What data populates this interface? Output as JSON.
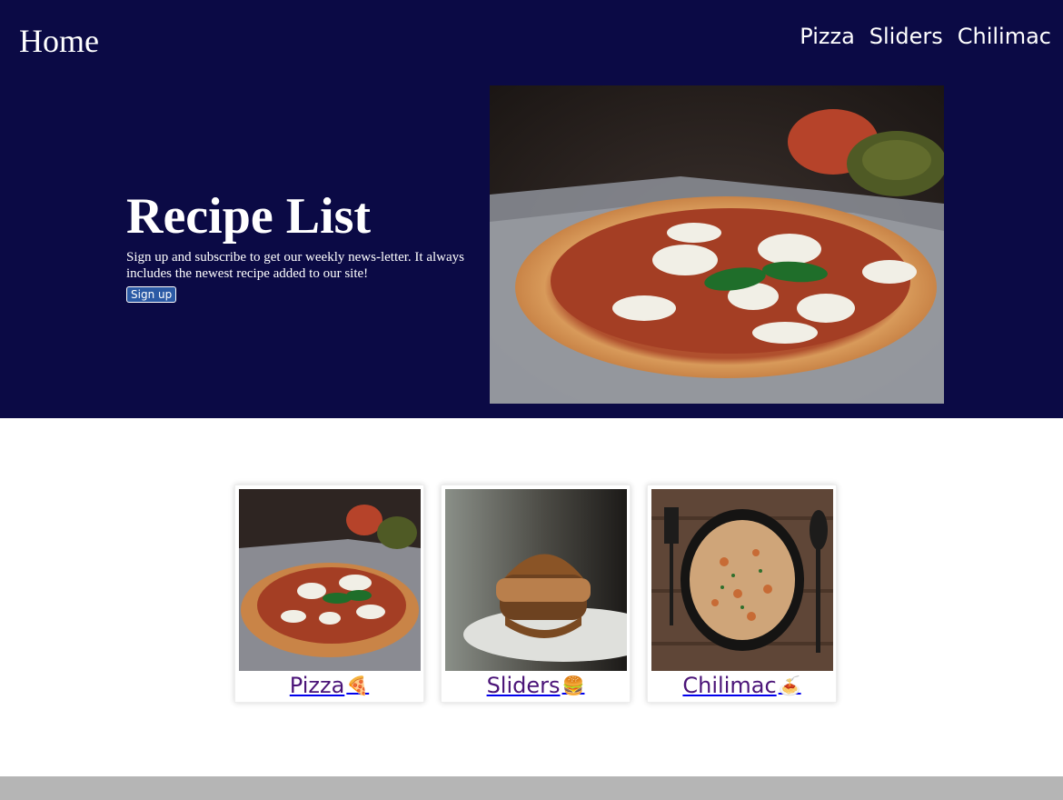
{
  "header": {
    "home_label": "Home",
    "nav": [
      {
        "label": "Pizza"
      },
      {
        "label": "Sliders"
      },
      {
        "label": "Chilimac"
      }
    ]
  },
  "hero": {
    "title": "Recipe List",
    "description": "Sign up and subscribe to get our weekly news-letter. It always includes the newest recipe added to our site!",
    "signup_label": "Sign up"
  },
  "cards": [
    {
      "label": "Pizza",
      "emoji": "🍕"
    },
    {
      "label": "Sliders",
      "emoji": "🍔"
    },
    {
      "label": "Chilimac",
      "emoji": "🍝"
    }
  ],
  "colors": {
    "header_bg": "#0b0a45",
    "card_text": "#4b1478",
    "button_bg": "#2b5aa5",
    "footer_bg": "#b5b5b5"
  }
}
